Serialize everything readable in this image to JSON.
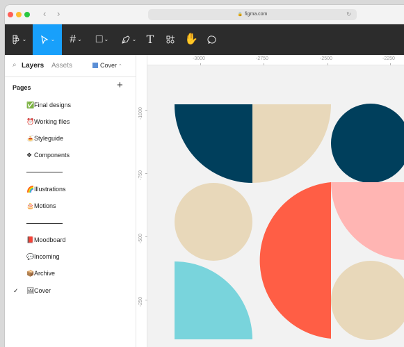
{
  "browser": {
    "url": "figma.com"
  },
  "sidebar": {
    "tabs": {
      "layers": "Layers",
      "assets": "Assets"
    },
    "current_page": "Cover",
    "pages_header": "Pages",
    "add_icon": "+",
    "pages": [
      {
        "emoji": "✅",
        "label": "Final designs",
        "selected": false
      },
      {
        "emoji": "⏰",
        "label": "Working files",
        "selected": false
      },
      {
        "emoji": "🍝",
        "label": "Styleguide",
        "selected": false
      },
      {
        "emoji": "❖",
        "label": "Components",
        "selected": false
      },
      {
        "emoji": "🌈",
        "label": "Illustrations",
        "selected": false
      },
      {
        "emoji": "🎂",
        "label": "Motions",
        "selected": false
      },
      {
        "emoji": "📕",
        "label": "Moodboard",
        "selected": false
      },
      {
        "emoji": "💬",
        "label": "Incoming",
        "selected": false
      },
      {
        "emoji": "📦",
        "label": "Archive",
        "selected": false
      },
      {
        "emoji": "🖼",
        "label": "Cover",
        "selected": true
      }
    ]
  },
  "rulers": {
    "horizontal": [
      "-3000",
      "-2750",
      "-2500",
      "-2250"
    ],
    "vertical": [
      "-1000",
      "-750",
      "-500",
      "-250"
    ]
  },
  "colors": {
    "navy": "#003f5c",
    "sand": "#e8d8ba",
    "coral": "#ff5e45",
    "pink": "#ffb5b3",
    "cyan": "#79d4dc",
    "toolbar": "#2c2c2c",
    "accent": "#18a0fb"
  }
}
